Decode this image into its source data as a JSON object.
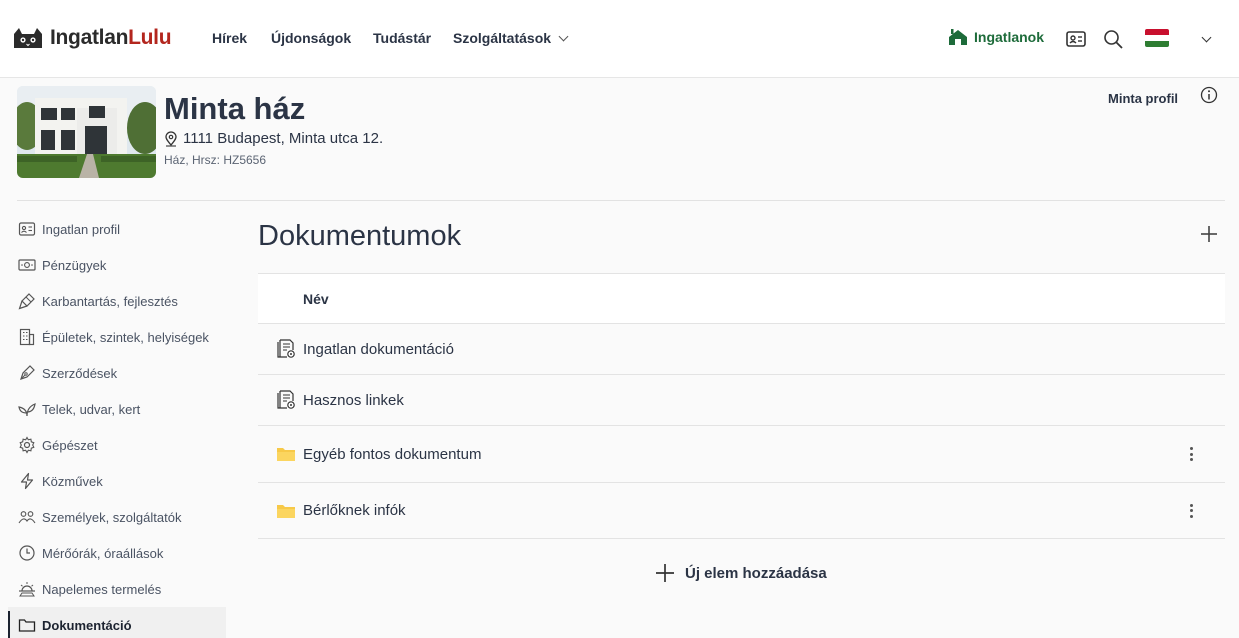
{
  "brand": {
    "part1": "Ingatlan",
    "part2": "Lulu"
  },
  "nav": {
    "items": [
      "Hírek",
      "Újdonságok",
      "Tudástár",
      "Szolgáltatások"
    ],
    "ingatlanok": "Ingatlanok"
  },
  "property": {
    "title": "Minta ház",
    "address": "1111 Budapest, Minta utca 12.",
    "type": "Ház, Hrsz: HZ5656",
    "profile_link": "Minta profil"
  },
  "sidebar": {
    "items": [
      {
        "label": "Ingatlan profil",
        "icon": "id-card-icon"
      },
      {
        "label": "Pénzügyek",
        "icon": "money-icon"
      },
      {
        "label": "Karbantartás, fejlesztés",
        "icon": "brush-icon"
      },
      {
        "label": "Épületek, szintek, helyiségek",
        "icon": "building-icon"
      },
      {
        "label": "Szerződések",
        "icon": "pen-icon"
      },
      {
        "label": "Telek, udvar, kert",
        "icon": "leaf-icon"
      },
      {
        "label": "Gépészet",
        "icon": "gear-icon"
      },
      {
        "label": "Közművek",
        "icon": "lightning-icon"
      },
      {
        "label": "Személyek, szolgáltatók",
        "icon": "people-icon"
      },
      {
        "label": "Mérőórák, óraállások",
        "icon": "clock-icon"
      },
      {
        "label": "Napelemes termelés",
        "icon": "sun-icon"
      },
      {
        "label": "Dokumentáció",
        "icon": "folder-icon",
        "active": true
      }
    ]
  },
  "main": {
    "title": "Dokumentumok",
    "column_name": "Név",
    "rows": [
      {
        "label": "Ingatlan dokumentáció",
        "icon": "document-icon"
      },
      {
        "label": "Hasznos linkek",
        "icon": "document-icon"
      },
      {
        "label": "Egyéb fontos dokumentum",
        "icon": "folder-icon"
      },
      {
        "label": "Bérlőknek infók",
        "icon": "folder-icon"
      }
    ],
    "add_new": "Új elem hozzáadása"
  },
  "colors": {
    "brand_red": "#b3261e",
    "green": "#1d6b3a",
    "folder": "#f7c948"
  }
}
